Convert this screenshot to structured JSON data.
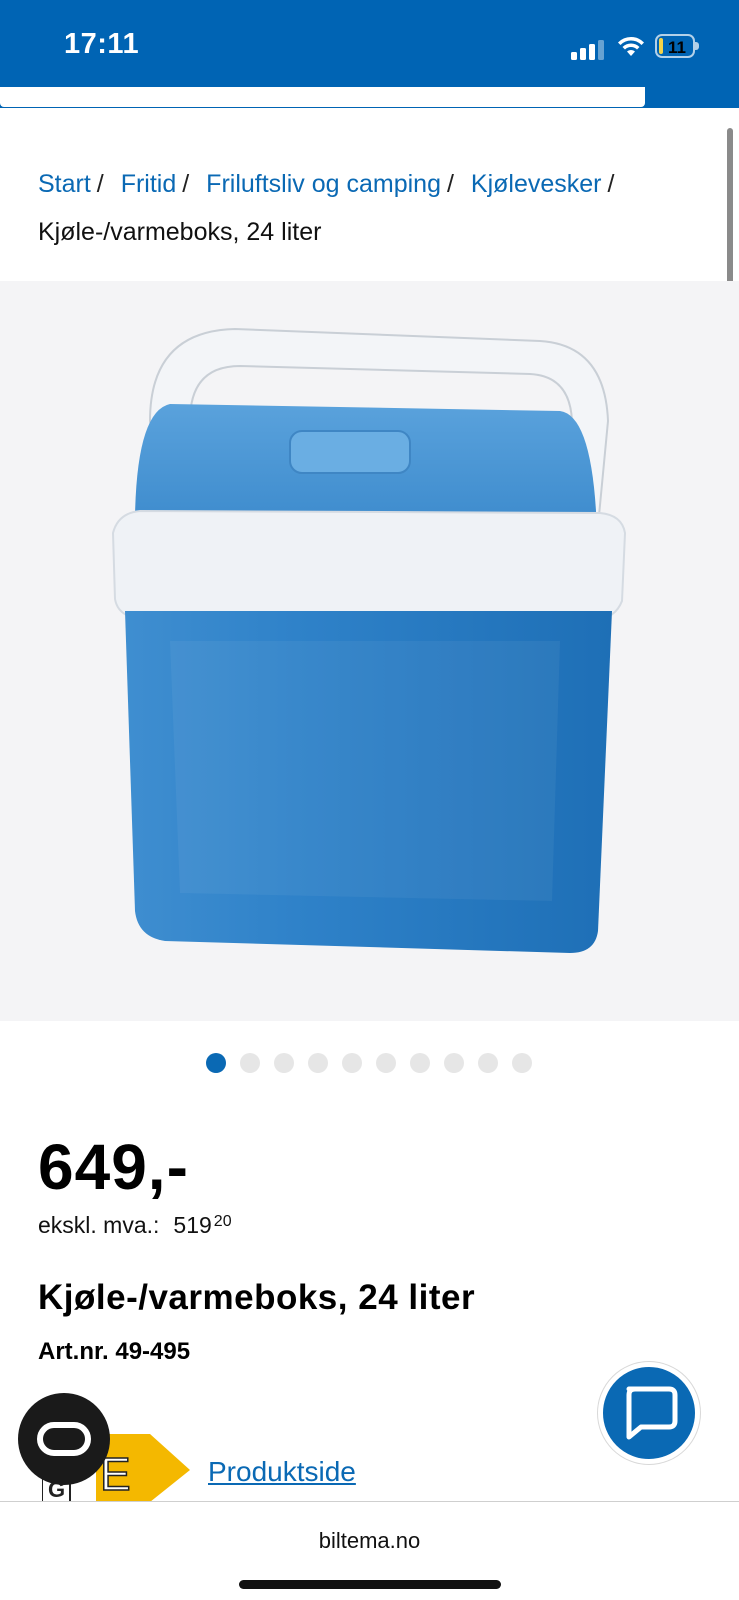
{
  "status_bar": {
    "time": "17:11",
    "battery_level": "11",
    "battery_fraction": 0.11,
    "icons": [
      "signal-icon",
      "wifi-icon",
      "battery-icon"
    ],
    "background": "#0064b4"
  },
  "breadcrumb": {
    "items": [
      "Start",
      "Fritid",
      "Friluftsliv og camping",
      "Kjølevesker"
    ],
    "separator": "/",
    "current": "Kjøle-/varmeboks, 24 liter"
  },
  "gallery": {
    "image_count": 10,
    "active_index": 0,
    "dot_active_color": "#0a69b4",
    "dot_inactive_color": "#e6e6e6"
  },
  "product": {
    "price": "649,-",
    "price_ex_vat_label": "ekskl. mva.:",
    "price_ex_vat_whole": "519",
    "price_ex_vat_cents": "20",
    "title": "Kjøle-/varmeboks, 24 liter",
    "article_number": "Art.nr. 49-495"
  },
  "energy_label": {
    "class": "E",
    "lowest_class": "G",
    "color": "#f4b800"
  },
  "links": {
    "product_page": "Produktside"
  },
  "floating": {
    "reader_icon": "reader-mode-icon",
    "chat_icon": "chat-bubble-icon"
  },
  "browser": {
    "domain": "biltema.no"
  },
  "colors": {
    "brand_blue": "#0064b4",
    "link_blue": "#0a69b4"
  }
}
